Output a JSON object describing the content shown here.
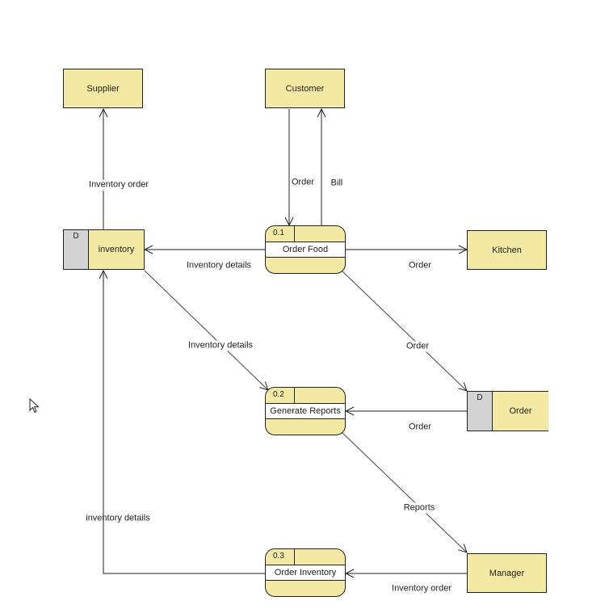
{
  "diagram": {
    "type": "data-flow-diagram",
    "external_entities": [
      {
        "id": "supplier",
        "label": "Supplier"
      },
      {
        "id": "customer",
        "label": "Customer"
      },
      {
        "id": "kitchen",
        "label": "Kitchen"
      },
      {
        "id": "manager",
        "label": "Manager"
      }
    ],
    "processes": [
      {
        "id": "p1",
        "number": "0.1",
        "label": "Order Food"
      },
      {
        "id": "p2",
        "number": "0.2",
        "label": "Generate Reports"
      },
      {
        "id": "p3",
        "number": "0.3",
        "label": "Order Inventory"
      }
    ],
    "data_stores": [
      {
        "id": "ds_inventory",
        "tag": "D",
        "label": "inventory"
      },
      {
        "id": "ds_order",
        "tag": "D",
        "label": "Order"
      }
    ],
    "flows": [
      {
        "from": "ds_inventory",
        "to": "supplier",
        "label": "Inventory order"
      },
      {
        "from": "customer",
        "to": "p1",
        "label": "Order"
      },
      {
        "from": "p1",
        "to": "customer",
        "label": "Bill"
      },
      {
        "from": "p1",
        "to": "ds_inventory",
        "label": "Inventory details"
      },
      {
        "from": "p1",
        "to": "kitchen",
        "label": "Order"
      },
      {
        "from": "ds_inventory",
        "to": "p2",
        "label": "Inventory details"
      },
      {
        "from": "p1",
        "to": "ds_order",
        "label": "Order"
      },
      {
        "from": "ds_order",
        "to": "p2",
        "label": "Order"
      },
      {
        "from": "p2",
        "to": "manager",
        "label": "Reports"
      },
      {
        "from": "p3",
        "to": "ds_inventory",
        "label": "inventory details"
      },
      {
        "from": "manager",
        "to": "p3",
        "label": "Inventory order"
      }
    ]
  },
  "colors": {
    "shape_fill": "#f3e9a3",
    "store_tag_fill": "#d3d3d3",
    "line": "#222222"
  },
  "cursor": {
    "icon": "mouse-pointer-icon"
  }
}
